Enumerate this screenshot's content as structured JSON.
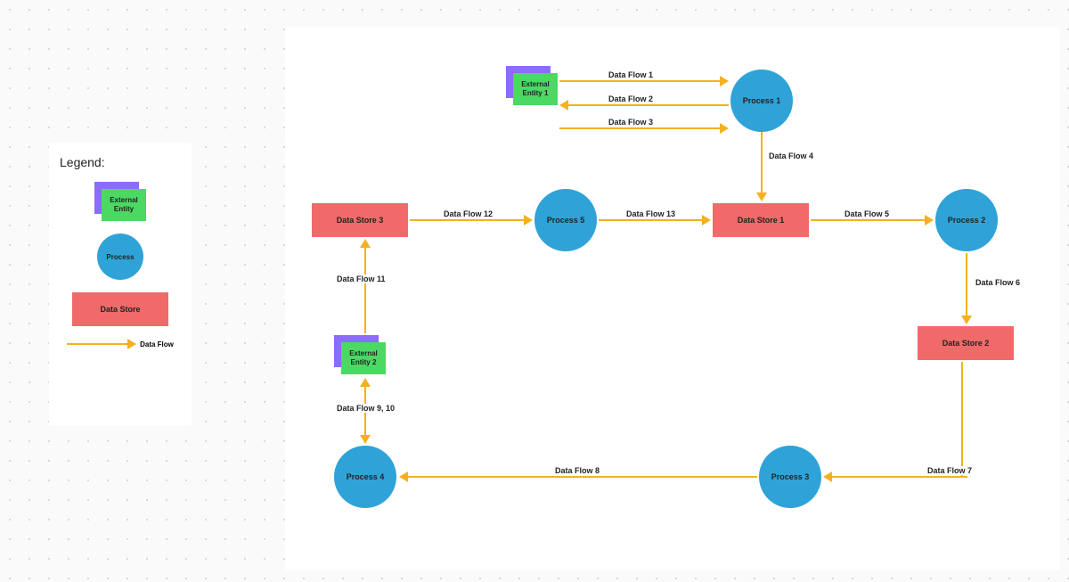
{
  "legend": {
    "title": "Legend:",
    "externalEntity": "External\nEntity",
    "process": "Process",
    "dataStore": "Data Store",
    "dataFlow": "Data Flow"
  },
  "nodes": {
    "externalEntity1": "External\nEntity 1",
    "externalEntity2": "External\nEntity 2",
    "process1": "Process 1",
    "process2": "Process 2",
    "process3": "Process 3",
    "process4": "Process 4",
    "process5": "Process 5",
    "dataStore1": "Data Store 1",
    "dataStore2": "Data Store 2",
    "dataStore3": "Data Store 3"
  },
  "flows": {
    "f1": "Data Flow 1",
    "f2": "Data Flow 2",
    "f3": "Data Flow 3",
    "f4": "Data Flow 4",
    "f5": "Data Flow 5",
    "f6": "Data Flow 6",
    "f7": "Data Flow 7",
    "f8": "Data Flow 8",
    "f9_10": "Data Flow 9, 10",
    "f11": "Data Flow 11",
    "f12": "Data Flow 12",
    "f13": "Data Flow 13"
  },
  "chart_data": {
    "type": "data-flow-diagram",
    "legend_items": [
      "External Entity",
      "Process",
      "Data Store",
      "Data Flow"
    ],
    "nodes": [
      {
        "id": "ee1",
        "type": "external_entity",
        "label": "External Entity 1"
      },
      {
        "id": "ee2",
        "type": "external_entity",
        "label": "External Entity 2"
      },
      {
        "id": "p1",
        "type": "process",
        "label": "Process 1"
      },
      {
        "id": "p2",
        "type": "process",
        "label": "Process 2"
      },
      {
        "id": "p3",
        "type": "process",
        "label": "Process 3"
      },
      {
        "id": "p4",
        "type": "process",
        "label": "Process 4"
      },
      {
        "id": "p5",
        "type": "process",
        "label": "Process 5"
      },
      {
        "id": "ds1",
        "type": "data_store",
        "label": "Data Store 1"
      },
      {
        "id": "ds2",
        "type": "data_store",
        "label": "Data Store 2"
      },
      {
        "id": "ds3",
        "type": "data_store",
        "label": "Data Store 3"
      }
    ],
    "edges": [
      {
        "from": "ee1",
        "to": "p1",
        "label": "Data Flow 1"
      },
      {
        "from": "p1",
        "to": "ee1",
        "label": "Data Flow 2"
      },
      {
        "from": "ee1",
        "to": "p1",
        "label": "Data Flow 3"
      },
      {
        "from": "p1",
        "to": "ds1",
        "label": "Data Flow 4"
      },
      {
        "from": "ds1",
        "to": "p2",
        "label": "Data Flow 5"
      },
      {
        "from": "p2",
        "to": "ds2",
        "label": "Data Flow 6"
      },
      {
        "from": "ds2",
        "to": "p3",
        "label": "Data Flow 7"
      },
      {
        "from": "p3",
        "to": "p4",
        "label": "Data Flow 8"
      },
      {
        "from": "p4",
        "to": "ee2",
        "label": "Data Flow 9, 10",
        "bidirectional": true
      },
      {
        "from": "ee2",
        "to": "ds3",
        "label": "Data Flow 11"
      },
      {
        "from": "ds3",
        "to": "p5",
        "label": "Data Flow 12"
      },
      {
        "from": "p5",
        "to": "ds1",
        "label": "Data Flow 13"
      }
    ]
  }
}
